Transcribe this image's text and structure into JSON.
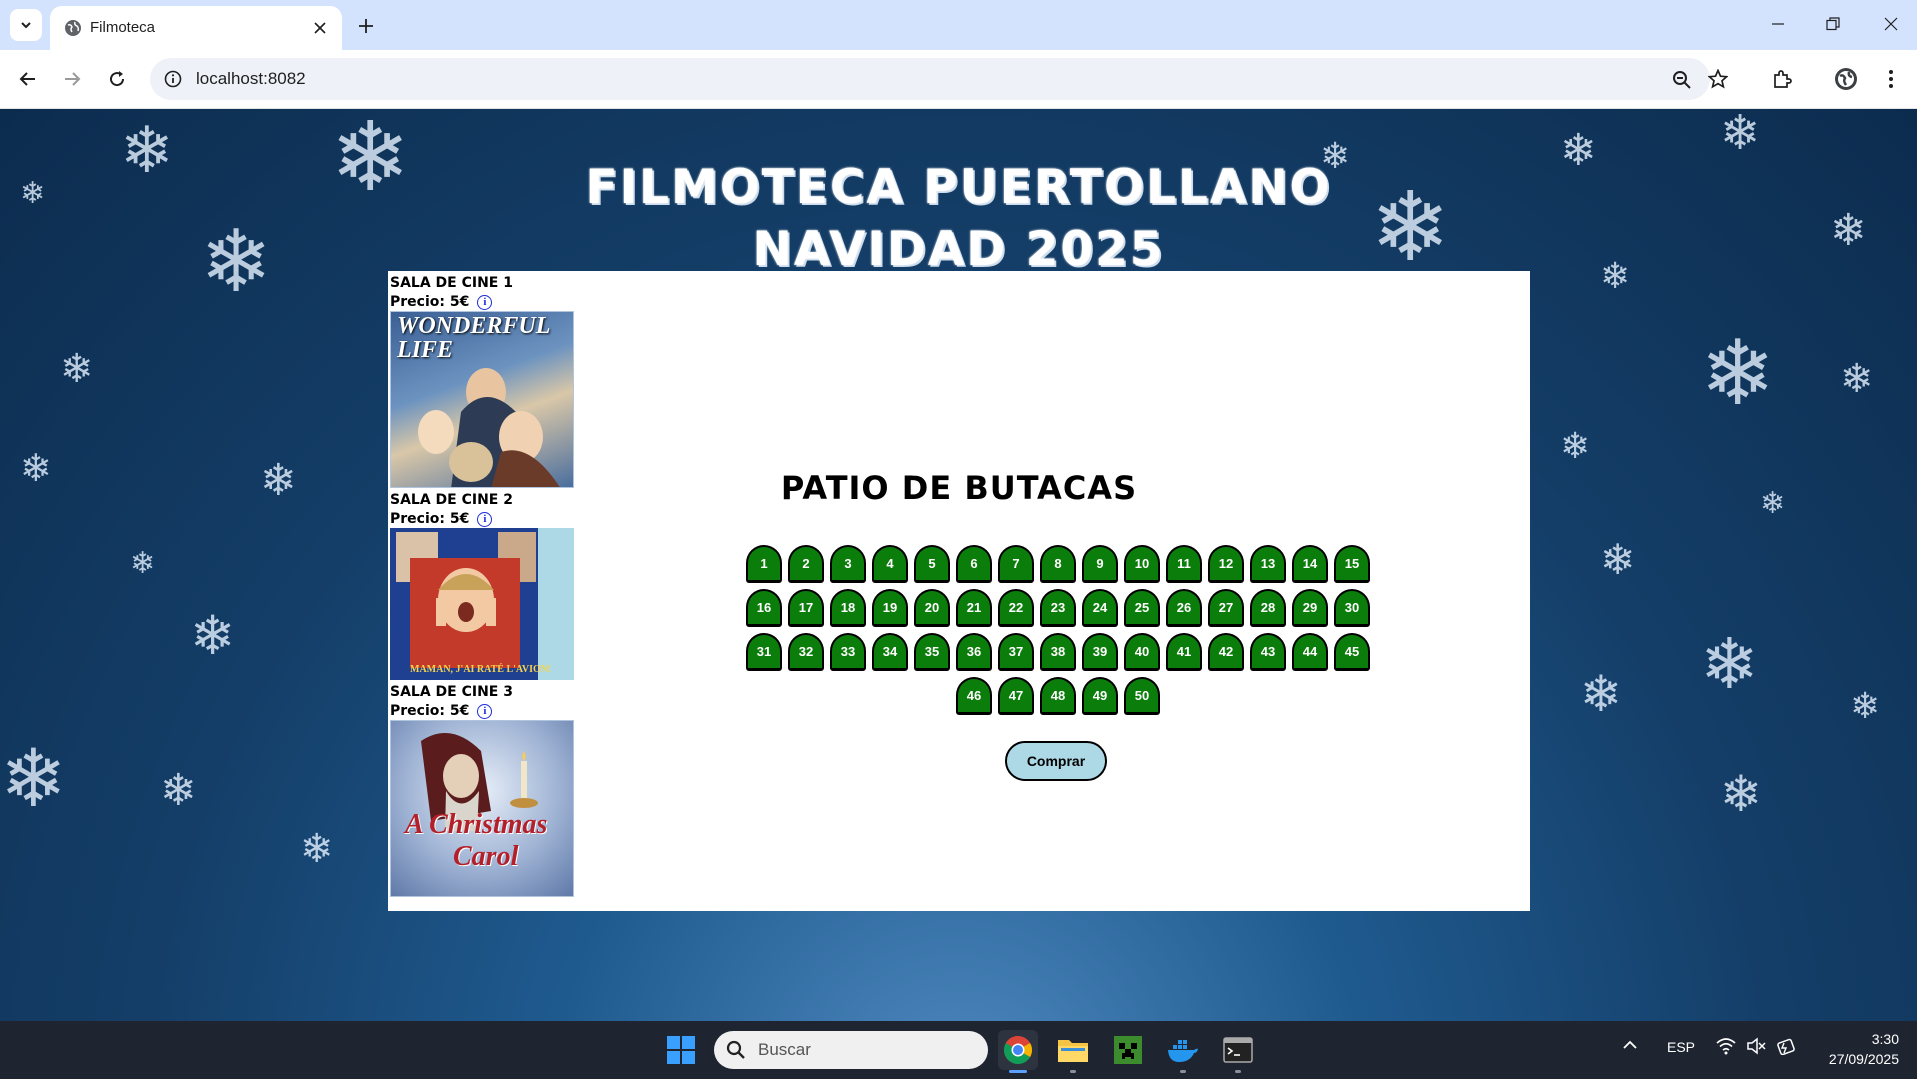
{
  "browser": {
    "tab_title": "Filmoteca",
    "url": "localhost:8082"
  },
  "page": {
    "site_title_line1": "FILMOTECA PUERTOLLANO",
    "site_title_line2": "NAVIDAD 2025",
    "salas": [
      {
        "name": "Sala de cine 1",
        "price": "Precio:  5€",
        "poster_text": "WONDERFUL LIFE",
        "poster_colors": [
          "#2b4a7c",
          "#5f86b5"
        ]
      },
      {
        "name": "Sala de cine 2",
        "price": "Precio:  5€",
        "poster_text": "MAMAN, J'AI RATÉ L'AVION!",
        "poster_colors": [
          "#1e3c8c",
          "#add8e6"
        ]
      },
      {
        "name": "Sala de cine 3",
        "price": "Precio:  5€",
        "poster_text_1": "A Christmas",
        "poster_text_2": "Carol",
        "poster_colors": [
          "#8ea3c8",
          "#d8e2f0"
        ]
      }
    ],
    "patio_title": "PATIO DE BUTACAS",
    "seat_rows": [
      [
        "1",
        "2",
        "3",
        "4",
        "5",
        "6",
        "7",
        "8",
        "9",
        "10",
        "11",
        "12",
        "13",
        "14",
        "15"
      ],
      [
        "16",
        "17",
        "18",
        "19",
        "20",
        "21",
        "22",
        "23",
        "24",
        "25",
        "26",
        "27",
        "28",
        "29",
        "30"
      ],
      [
        "31",
        "32",
        "33",
        "34",
        "35",
        "36",
        "37",
        "38",
        "39",
        "40",
        "41",
        "42",
        "43",
        "44",
        "45"
      ],
      [
        "46",
        "47",
        "48",
        "49",
        "50"
      ]
    ],
    "seat_color": "#0b7d0b",
    "buy_label": "Comprar"
  },
  "taskbar": {
    "search_placeholder": "Buscar",
    "language": "ESP",
    "time": "3:30",
    "date": "27/09/2025"
  }
}
